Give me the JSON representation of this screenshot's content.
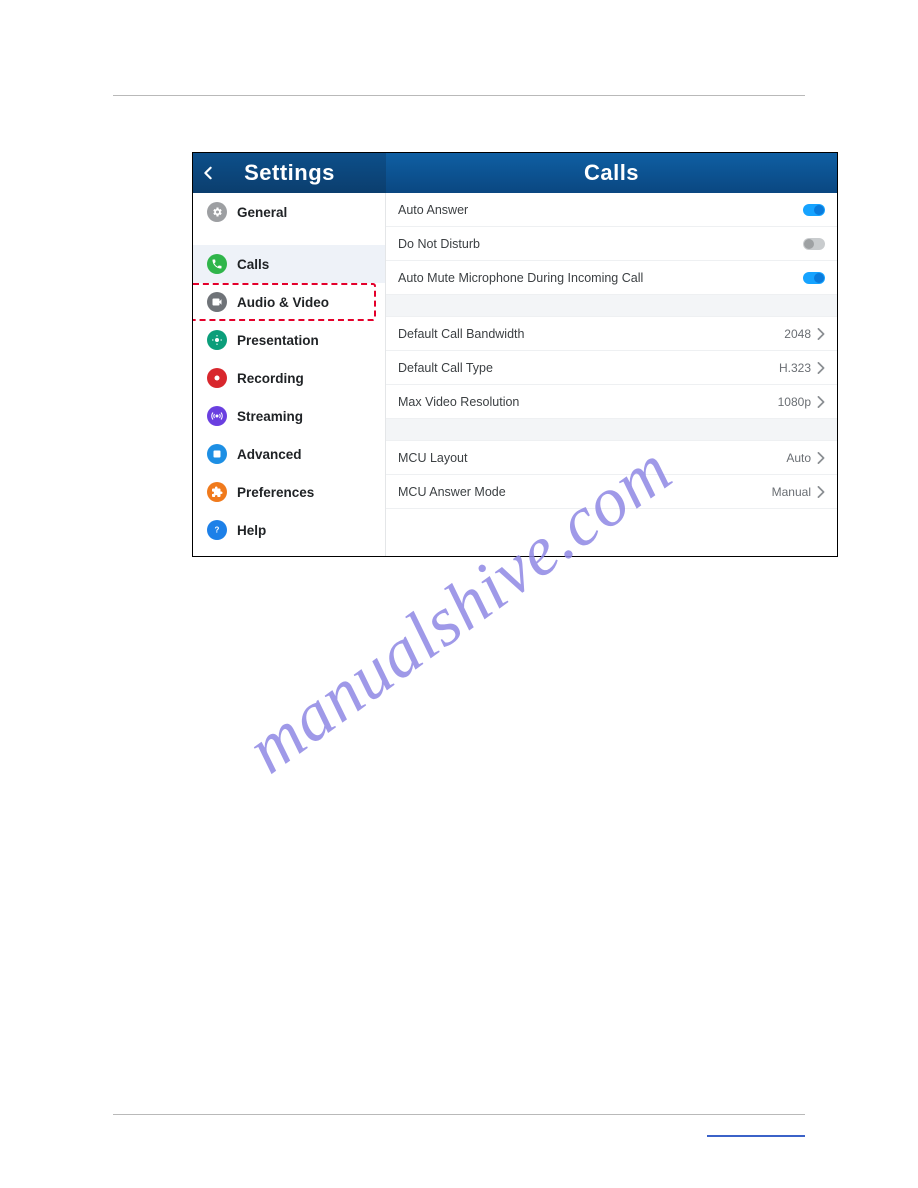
{
  "watermark": "manualshive.com",
  "topbar": {
    "left_title": "Settings",
    "right_title": "Calls"
  },
  "sidebar": {
    "items": [
      {
        "label": "General"
      },
      {
        "label": "Calls"
      },
      {
        "label": "Audio & Video"
      },
      {
        "label": "Presentation"
      },
      {
        "label": "Recording"
      },
      {
        "label": "Streaming"
      },
      {
        "label": "Advanced"
      },
      {
        "label": "Preferences"
      },
      {
        "label": "Help"
      }
    ],
    "selected_index": 1,
    "highlighted_index": 1
  },
  "content": {
    "group1": [
      {
        "label": "Auto Answer",
        "type": "toggle",
        "value": "on"
      },
      {
        "label": "Do Not Disturb",
        "type": "toggle",
        "value": "off"
      },
      {
        "label": "Auto Mute Microphone During Incoming Call",
        "type": "toggle",
        "value": "on"
      }
    ],
    "group2": [
      {
        "label": "Default Call Bandwidth",
        "type": "nav",
        "value": "2048"
      },
      {
        "label": "Default Call Type",
        "type": "nav",
        "value": "H.323"
      },
      {
        "label": "Max Video Resolution",
        "type": "nav",
        "value": "1080p"
      }
    ],
    "group3": [
      {
        "label": "MCU Layout",
        "type": "nav",
        "value": "Auto"
      },
      {
        "label": "MCU Answer Mode",
        "type": "nav",
        "value": "Manual"
      }
    ]
  }
}
